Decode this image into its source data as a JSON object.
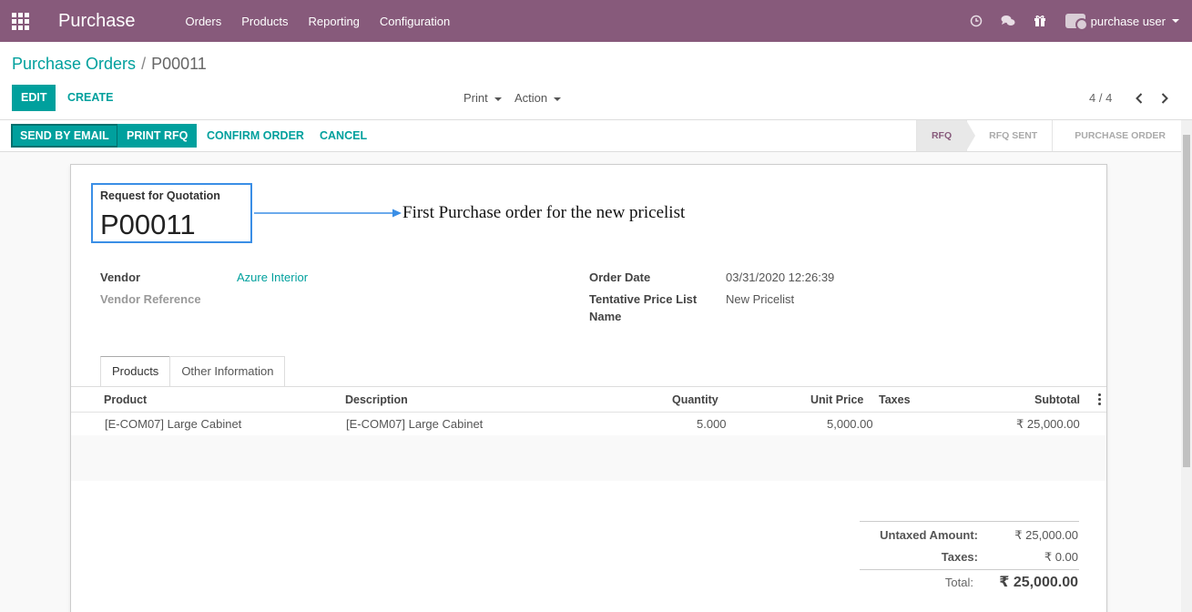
{
  "navbar": {
    "app_name": "Purchase",
    "menu": [
      "Orders",
      "Products",
      "Reporting",
      "Configuration"
    ],
    "user_name": "purchase user",
    "color": "#875a7b"
  },
  "breadcrumb": {
    "parent": "Purchase Orders",
    "separator": "/",
    "current": "P00011"
  },
  "control": {
    "edit_label": "EDIT",
    "create_label": "CREATE",
    "print_label": "Print",
    "action_label": "Action",
    "pager": "4 / 4"
  },
  "statusbar": {
    "buttons": [
      "SEND BY EMAIL",
      "PRINT RFQ",
      "CONFIRM ORDER",
      "CANCEL"
    ],
    "stages": [
      "RFQ",
      "RFQ SENT",
      "PURCHASE ORDER"
    ],
    "active_stage": "RFQ"
  },
  "form": {
    "title_label": "Request for Quotation",
    "title_name": "P00011",
    "annotation": "First Purchase order for the new pricelist",
    "vendor_label": "Vendor",
    "vendor_value": "Azure Interior",
    "vendor_ref_label": "Vendor Reference",
    "order_date_label": "Order Date",
    "order_date_value": "03/31/2020 12:26:39",
    "pricelist_label_1": "Tentative Price List",
    "pricelist_label_2": "Name",
    "pricelist_value": "New Pricelist"
  },
  "tabs": [
    "Products",
    "Other Information"
  ],
  "table": {
    "headers": [
      "Product",
      "Description",
      "Quantity",
      "Unit Price",
      "Taxes",
      "Subtotal"
    ],
    "rows": [
      {
        "product": "[E-COM07] Large Cabinet",
        "description": "[E-COM07] Large Cabinet",
        "quantity": "5.000",
        "unit_price": "5,000.00",
        "taxes": "",
        "subtotal": "₹ 25,000.00"
      }
    ]
  },
  "totals": {
    "untaxed_label": "Untaxed Amount:",
    "untaxed_value": "₹ 25,000.00",
    "taxes_label": "Taxes:",
    "taxes_value": "₹ 0.00",
    "total_label": "Total:",
    "total_value": "₹ 25,000.00"
  }
}
